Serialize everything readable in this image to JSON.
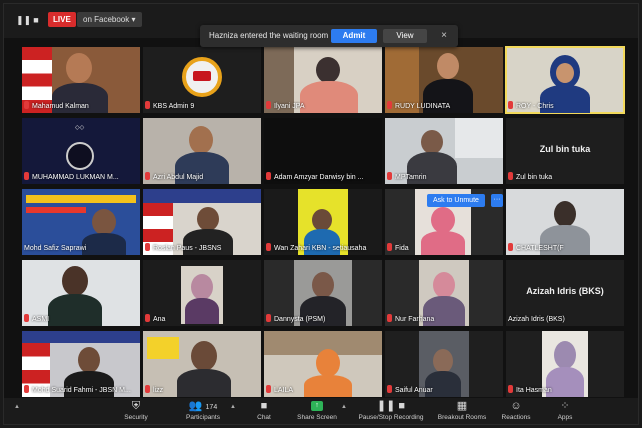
{
  "topbar": {
    "live_label": "LIVE",
    "stream_target": "on Facebook ▾"
  },
  "notification": {
    "message": "Hazniza entered the waiting room",
    "admit_label": "Admit",
    "view_label": "View",
    "close_glyph": "×"
  },
  "unmute_popup": {
    "label": "Ask to Unmute",
    "more": "···"
  },
  "participants": [
    {
      "name": "Mahamud Kalman",
      "muted": true
    },
    {
      "name": "KBS Admin 9",
      "muted": true
    },
    {
      "name": "Ilyani JPA",
      "muted": true
    },
    {
      "name": "RUDY LUDINATA",
      "muted": true
    },
    {
      "name": "ROY - Chris",
      "muted": true
    },
    {
      "name": "MUHAMMAD LUKMAN M...",
      "muted": true
    },
    {
      "name": "Azri Abdul Majid",
      "muted": true
    },
    {
      "name": "Adam Amzyar Darwisy bin ...",
      "muted": true
    },
    {
      "name": "MPTamrin",
      "muted": true
    },
    {
      "name": "Zul bin tuka",
      "muted": true,
      "big_label": "Zul bin tuka"
    },
    {
      "name": "Mohd Safiz Saprawi",
      "muted": false
    },
    {
      "name": "Roslan Paus - JBSNS",
      "muted": true
    },
    {
      "name": "Wan Zahari KBN - setiausaha",
      "muted": true
    },
    {
      "name": "Fida",
      "muted": true
    },
    {
      "name": "CHATLESHT(F",
      "muted": true
    },
    {
      "name": "ASMI",
      "muted": true
    },
    {
      "name": "Ana",
      "muted": true
    },
    {
      "name": "Dannysta (PSM)",
      "muted": true
    },
    {
      "name": "Nur Farhana",
      "muted": true
    },
    {
      "name": "Azizah Idris (BKS)",
      "muted": false,
      "big_label": "Azizah Idris (BKS)"
    },
    {
      "name": "Mohd Suarid Fahmi - JBSN M...",
      "muted": true
    },
    {
      "name": "lizz",
      "muted": true
    },
    {
      "name": "LAILA",
      "muted": true
    },
    {
      "name": "Saiful Anuar",
      "muted": true
    },
    {
      "name": "Ita Hasman",
      "muted": true
    }
  ],
  "toolbar": {
    "security": "Security",
    "participants": "Participants",
    "participants_count": "174",
    "chat": "Chat",
    "share_screen": "Share Screen",
    "recording": "Pause/Stop Recording",
    "breakout": "Breakout Rooms",
    "reactions": "Reactions",
    "apps": "Apps"
  },
  "colors": {
    "accent": "#2d7cf0",
    "live": "#d82c2c",
    "share": "#2eb358",
    "active_speaker": "#f2d95b"
  }
}
